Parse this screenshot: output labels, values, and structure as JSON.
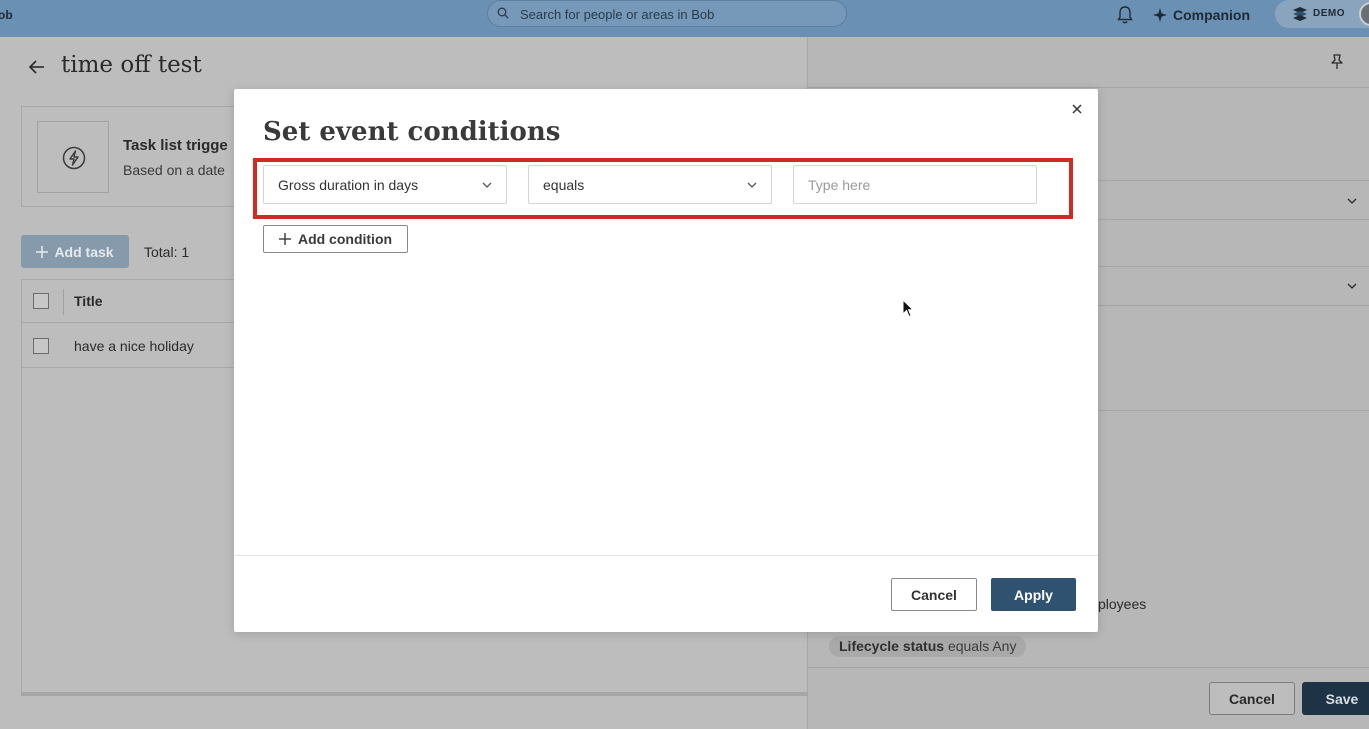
{
  "topbar": {
    "logo_text": "ob",
    "search_placeholder": "Search for people or areas in Bob",
    "companion_label": "Companion",
    "demo_label": "DEMO"
  },
  "page": {
    "title": "time off test",
    "trigger_card": {
      "title": "Task list trigge",
      "subtitle": "Based on a date"
    },
    "add_task_label": "Add task",
    "total_label": "Total: 1",
    "table": {
      "columns": [
        "Title"
      ],
      "rows": [
        {
          "title": "have a nice holiday"
        }
      ]
    }
  },
  "right_panel": {
    "employees_text": "ployees",
    "lifecycle_label": "Lifecycle status",
    "lifecycle_value": "equals Any",
    "cancel_label": "Cancel",
    "save_label": "Save"
  },
  "modal": {
    "title": "Set event conditions",
    "condition": {
      "field": "Gross duration in days",
      "operator": "equals",
      "value_placeholder": "Type here",
      "value": ""
    },
    "add_condition_label": "Add condition",
    "cancel_label": "Cancel",
    "apply_label": "Apply"
  },
  "colors": {
    "topbar": "#6a91b4",
    "highlight_border": "#d12a24",
    "apply_button": "#2f5271",
    "save_button": "#1f3347"
  },
  "icons": [
    "search-icon",
    "bell-icon",
    "sparkle-icon",
    "demo-logo-icon",
    "back-arrow-icon",
    "lightning-icon",
    "plus-icon",
    "pin-icon",
    "chevron-down-icon",
    "close-icon",
    "cursor-icon"
  ]
}
